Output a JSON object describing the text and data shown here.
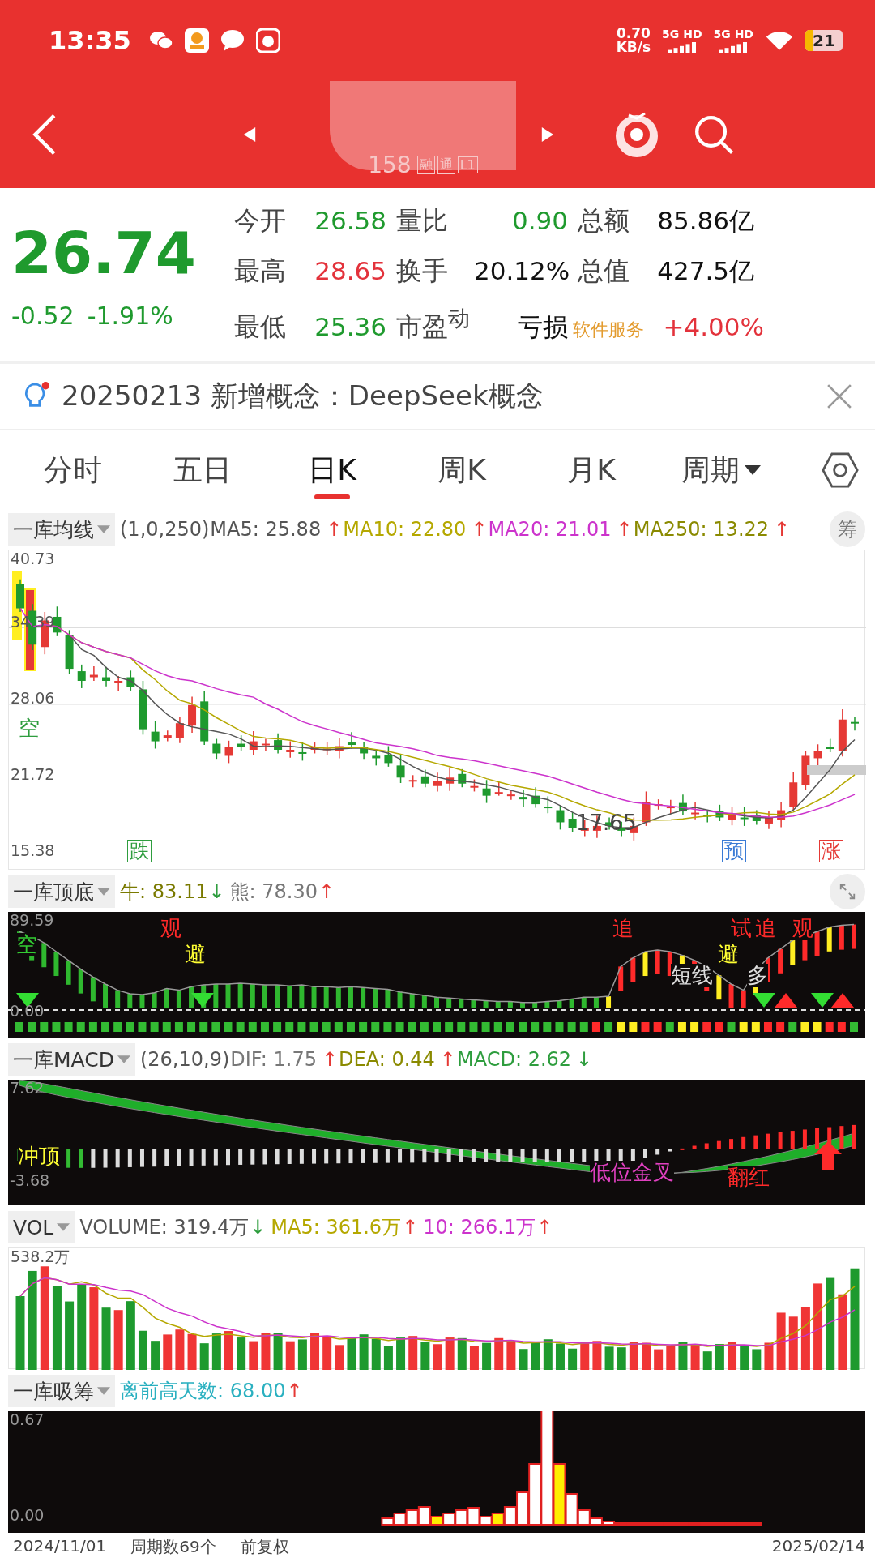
{
  "status_bar": {
    "time": "13:35",
    "net_speed": "0.70",
    "net_unit": "KB/s",
    "signals": [
      "5G HD",
      "5G HD"
    ],
    "battery": "21"
  },
  "header": {
    "code_fragment": "158",
    "tags": [
      "融",
      "通",
      "L1"
    ]
  },
  "quote": {
    "price": "26.74",
    "change": "-0.52",
    "change_pct": "-1.91%",
    "stats": [
      {
        "label": "今开",
        "value": "26.58",
        "color": "#1f9a2e",
        "kind": "stat"
      },
      {
        "label": "量比",
        "value": "0.90",
        "color": "#1f9a2e",
        "kind": "stat"
      },
      {
        "label": "总额",
        "value": "85.86亿",
        "color": "#111111",
        "kind": "stat"
      },
      {
        "label": "最高",
        "value": "28.65",
        "color": "#e3323b",
        "kind": "stat"
      },
      {
        "label": "换手",
        "value": "20.12%",
        "color": "#111111",
        "kind": "stat"
      },
      {
        "label": "总值",
        "value": "427.5亿",
        "color": "#111111",
        "kind": "stat"
      },
      {
        "label": "最低",
        "value": "25.36",
        "color": "#1f9a2e",
        "kind": "stat"
      },
      {
        "label": "市盈$^{动}$",
        "value": "亏损",
        "color": "#111111",
        "kind": "stat"
      },
      {
        "label": "软件服务",
        "value": "+4.00%",
        "color": "#e3323b",
        "kind": "sector"
      }
    ]
  },
  "concept": {
    "text": "20250213 新增概念：DeepSeek概念"
  },
  "tabs": [
    {
      "label": "分时",
      "selected": false,
      "dropdown": false
    },
    {
      "label": "五日",
      "selected": false,
      "dropdown": false
    },
    {
      "label": "日K",
      "selected": true,
      "dropdown": false
    },
    {
      "label": "周K",
      "selected": false,
      "dropdown": false
    },
    {
      "label": "月K",
      "selected": false,
      "dropdown": false
    },
    {
      "label": "周期",
      "selected": false,
      "dropdown": true
    }
  ],
  "panels": [
    {
      "indicator": "一库均线",
      "action": {
        "kind": "text",
        "text": "筹"
      },
      "legend": [
        {
          "text": "(1,0,250)",
          "color": "#555555"
        },
        {
          "text": "MA5: 25.88",
          "color": "#555555"
        },
        {
          "text": "↑",
          "color": "#e53935"
        },
        {
          "text": "MA10: 22.80",
          "color": "#b5a800"
        },
        {
          "text": "↑",
          "color": "#e53935"
        },
        {
          "text": "MA20: 21.01",
          "color": "#cc33cc"
        },
        {
          "text": "↑",
          "color": "#e53935"
        },
        {
          "text": "MA250: 13.22",
          "color": "#8a8a00"
        },
        {
          "text": "↑",
          "color": "#e53935"
        }
      ],
      "chart": {
        "kind": "candles",
        "y_labels": [
          "40.73",
          "34.39",
          "28.06",
          "21.72",
          "15.38"
        ],
        "markers": [
          {
            "text": "空",
            "color": "#2e9d3e",
            "boxed": false
          },
          {
            "text": "17.65",
            "color": "#444444",
            "boxed": false
          },
          {
            "text": "跌",
            "color": "#2e9d3e",
            "boxed": true
          },
          {
            "text": "预",
            "color": "#3a7bd5",
            "boxed": true
          },
          {
            "text": "涨",
            "color": "#e53935",
            "boxed": true
          }
        ]
      }
    },
    {
      "indicator": "一库顶底",
      "action": {
        "kind": "expand"
      },
      "legend": [
        {
          "text": "牛: 83.11",
          "color": "#7a7a00"
        },
        {
          "text": "↓",
          "color": "#2e9d3e"
        },
        {
          "text": "熊: 78.30",
          "color": "#777777"
        },
        {
          "text": "↑",
          "color": "#e53935"
        }
      ],
      "chart": {
        "kind": "topbottom",
        "y_labels": [
          "89.59",
          "0.00"
        ],
        "markers": [
          {
            "text": "空",
            "color": "#33cc33",
            "boxed": false
          },
          {
            "text": "观",
            "color": "#ff2a2a",
            "boxed": false
          },
          {
            "text": "避",
            "color": "#ffff33",
            "boxed": false
          },
          {
            "text": "追",
            "color": "#ff2a2a",
            "boxed": false
          },
          {
            "text": "避",
            "color": "#ffff33",
            "boxed": false
          },
          {
            "text": "短线",
            "color": "#dddddd",
            "boxed": false
          },
          {
            "text": "多",
            "color": "#dddddd",
            "boxed": false
          },
          {
            "text": "试",
            "color": "#ff2a2a",
            "boxed": false
          },
          {
            "text": "追",
            "color": "#ff2a2a",
            "boxed": false
          },
          {
            "text": "观",
            "color": "#ff2a2a",
            "boxed": false
          }
        ]
      }
    },
    {
      "indicator": "一库MACD",
      "legend": [
        {
          "text": "(26,10,9)",
          "color": "#555555"
        },
        {
          "text": "DIF: 1.75",
          "color": "#777777"
        },
        {
          "text": "↑",
          "color": "#e53935"
        },
        {
          "text": "DEA: 0.44",
          "color": "#8a8a00"
        },
        {
          "text": "↑",
          "color": "#e53935"
        },
        {
          "text": "MACD: 2.62",
          "color": "#2e9d3e"
        },
        {
          "text": "↓",
          "color": "#2e9d3e"
        }
      ],
      "chart": {
        "kind": "macd",
        "y_labels": [
          "7.62",
          "-3.68"
        ],
        "markers": [
          {
            "text": "冲顶",
            "color": "#ffff33",
            "boxed": false
          },
          {
            "text": "低位金叉",
            "color": "#e040c0",
            "boxed": false
          },
          {
            "text": "翻红",
            "color": "#ff2a2a",
            "boxed": false
          }
        ]
      }
    },
    {
      "indicator": "VOL",
      "legend": [
        {
          "text": "VOLUME: 319.4万",
          "color": "#555555"
        },
        {
          "text": "↓",
          "color": "#2e9d3e"
        },
        {
          "text": "MA5: 361.6万",
          "color": "#b5a800"
        },
        {
          "text": "↑",
          "color": "#e53935"
        },
        {
          "text": "10: 266.1万",
          "color": "#cc33cc"
        },
        {
          "text": "↑",
          "color": "#e53935"
        }
      ],
      "chart": {
        "kind": "volume",
        "y_labels": [
          "538.2万"
        ]
      }
    },
    {
      "indicator": "一库吸筹",
      "legend": [
        {
          "text": "离前高天数: 68.00",
          "color": "#2ab0c0"
        },
        {
          "text": "↑",
          "color": "#e53935"
        }
      ],
      "chart": {
        "kind": "accumulation",
        "y_labels": [
          "0.67",
          "0.00"
        ]
      }
    }
  ],
  "footer": {
    "start": "2024/11/01",
    "periods": "周期数69个",
    "adjust": "前复权",
    "end": "2025/02/14"
  }
}
